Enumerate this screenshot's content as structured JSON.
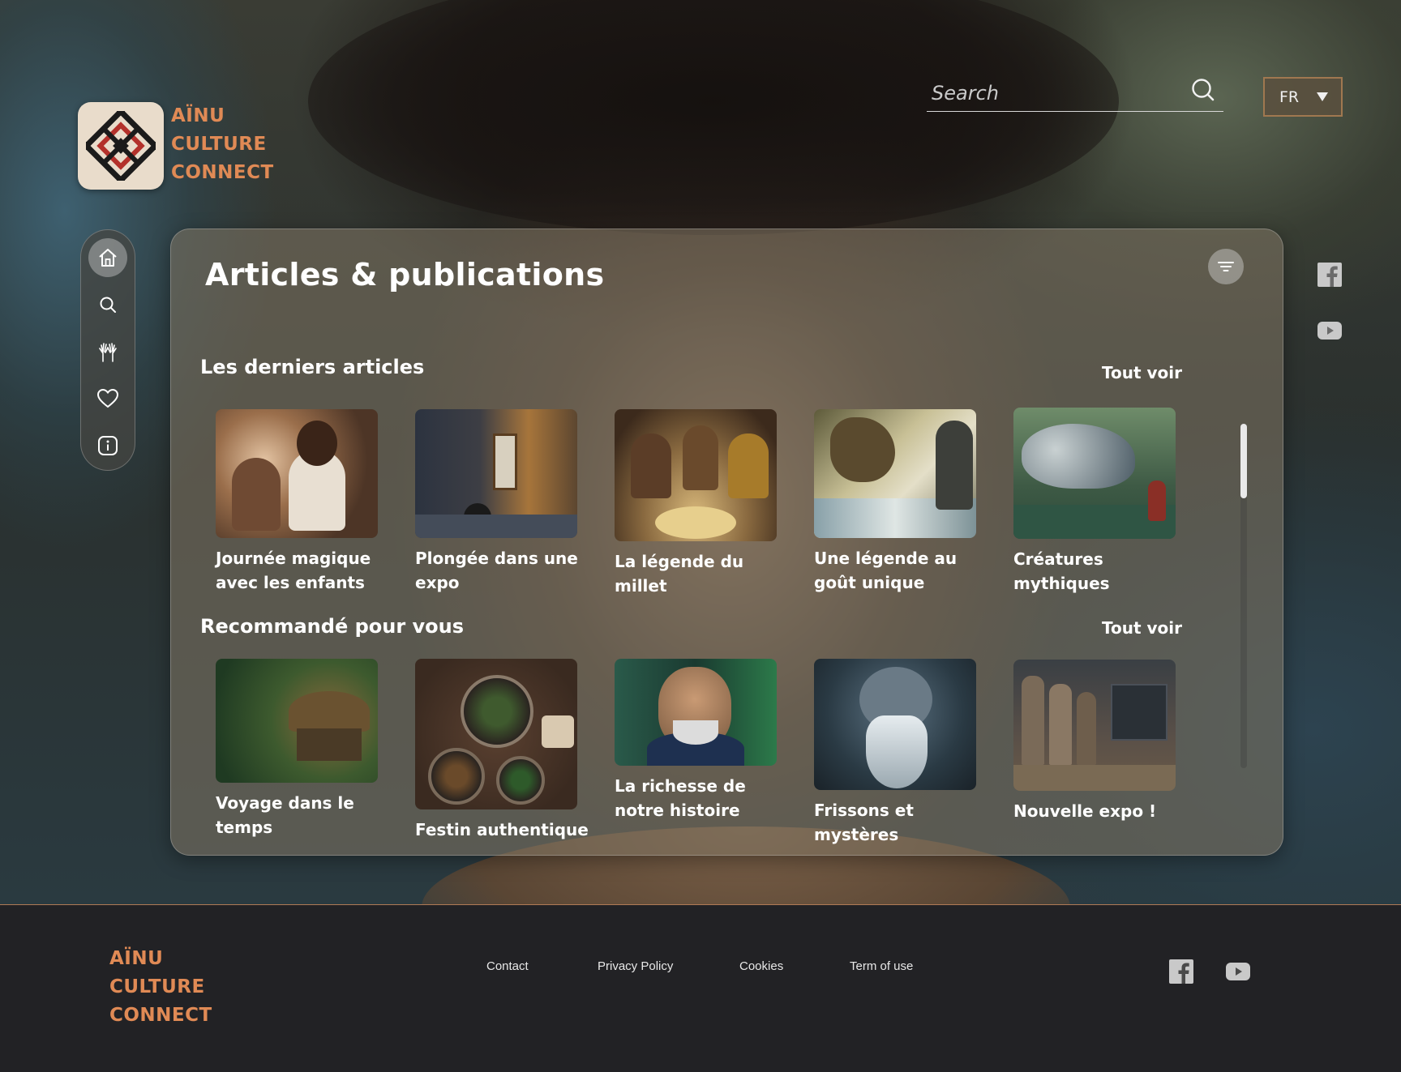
{
  "brand": {
    "line1": "AÏNU",
    "line2": "CULTURE",
    "line3": "CONNECT",
    "accent_color": "#e08a55"
  },
  "header": {
    "search_placeholder": "Search",
    "language": "FR"
  },
  "sidebar": {
    "items": [
      {
        "icon": "home-icon",
        "active": true
      },
      {
        "icon": "search-icon",
        "active": false
      },
      {
        "icon": "hands-icon",
        "active": false
      },
      {
        "icon": "heart-icon",
        "active": false
      },
      {
        "icon": "info-icon",
        "active": false
      }
    ]
  },
  "social": {
    "icons": [
      "facebook-icon",
      "youtube-icon"
    ]
  },
  "main": {
    "title": "Articles & publications",
    "sections": [
      {
        "title": "Les derniers articles",
        "see_all": "Tout voir",
        "cards": [
          {
            "title": "Journée magique avec les enfants"
          },
          {
            "title": "Plongée dans une expo"
          },
          {
            "title": "La légende du millet"
          },
          {
            "title": "Une légende au goût unique"
          },
          {
            "title": "Créatures mythiques"
          }
        ]
      },
      {
        "title": "Recommandé pour vous",
        "see_all": "Tout voir",
        "cards": [
          {
            "title": "Voyage dans le temps"
          },
          {
            "title": "Festin authentique"
          },
          {
            "title": "La richesse de notre histoire"
          },
          {
            "title": "Frissons et mystères"
          },
          {
            "title": "Nouvelle expo !"
          }
        ]
      }
    ]
  },
  "footer": {
    "links": [
      "Contact",
      "Privacy Policy",
      "Cookies",
      "Term of use"
    ]
  }
}
